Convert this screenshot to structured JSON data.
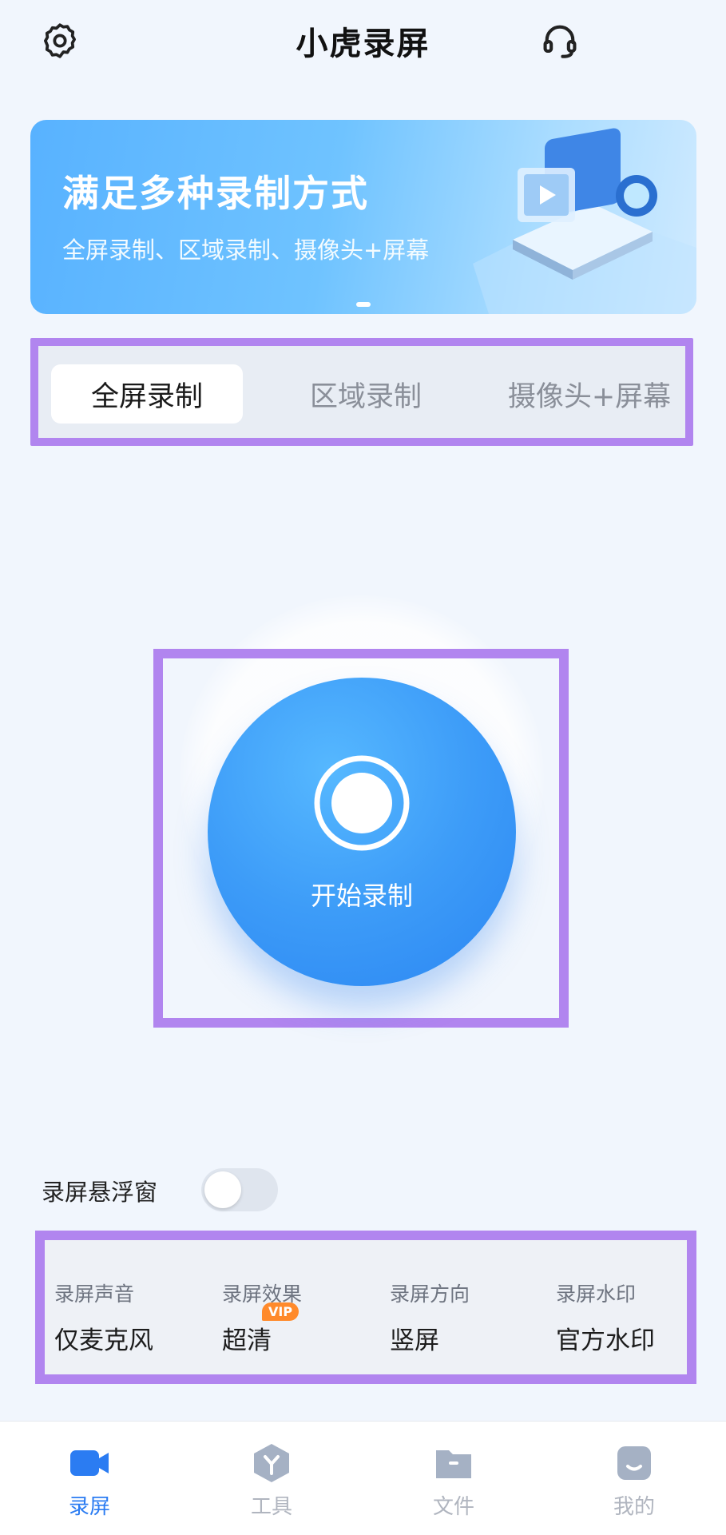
{
  "header": {
    "title": "小虎录屏",
    "settings_icon": "gear-icon",
    "support_icon": "headset-icon"
  },
  "banner": {
    "title": "满足多种录制方式",
    "subtitle": "全屏录制、区域录制、摄像头+屏幕",
    "art_icon": "camera-projector-illustration"
  },
  "mode_tabs": [
    {
      "label": "全屏录制",
      "active": true
    },
    {
      "label": "区域录制",
      "active": false
    },
    {
      "label": "摄像头+屏幕",
      "active": false
    }
  ],
  "record": {
    "label": "开始录制",
    "icon": "record-icon",
    "color": "#3d9cf8"
  },
  "float_window": {
    "label": "录屏悬浮窗",
    "enabled": false
  },
  "settings": [
    {
      "label": "录屏声音",
      "value": "仅麦克风"
    },
    {
      "label": "录屏效果",
      "value": "超清",
      "badge": "VIP"
    },
    {
      "label": "录屏方向",
      "value": "竖屏"
    },
    {
      "label": "录屏水印",
      "value": "官方水印"
    }
  ],
  "nav": [
    {
      "label": "录屏",
      "icon": "video-camera-icon",
      "active": true
    },
    {
      "label": "工具",
      "icon": "tools-hexagon-icon",
      "active": false
    },
    {
      "label": "文件",
      "icon": "folder-icon",
      "active": false
    },
    {
      "label": "我的",
      "icon": "profile-icon",
      "active": false
    }
  ],
  "colors": {
    "accent": "#2b7cf2",
    "highlight_frame": "#b185ef",
    "vip": "#ff8a2b"
  }
}
